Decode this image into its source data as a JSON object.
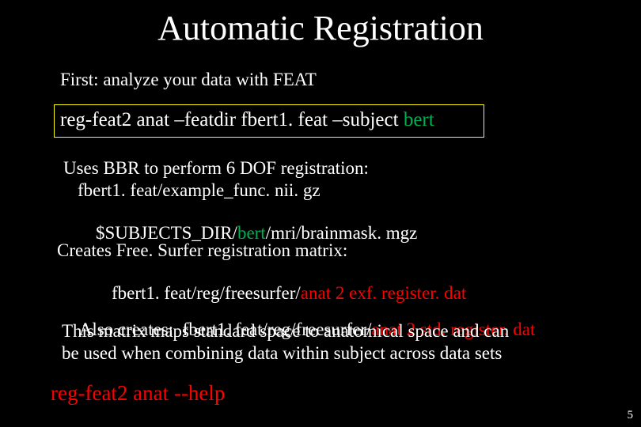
{
  "title": "Automatic Registration",
  "first": "First: analyze your data with FEAT",
  "cmd": {
    "pre": "reg-feat2 anat –featdir fbert1. feat –subject ",
    "subj": "bert"
  },
  "uses": {
    "l1": "Uses BBR to perform 6 DOF registration:",
    "l2": "fbert1. feat/example_func. nii. gz",
    "l3a": "$SUBJECTS_DIR/",
    "l3b": "bert",
    "l3c": "/mri/brainmask. mgz"
  },
  "creates": {
    "l1": "Creates Free. Surfer registration matrix:",
    "l2a": "fbert1. feat/reg/freesurfer/",
    "l2b": "anat 2 exf. register. dat"
  },
  "also": {
    "l1a": "Also creates:  fbert1. feat/reg/freesurfer/",
    "l1b": "anat 2 std. register. dat",
    "l2": "This matrix maps standard space to anatomical space and can",
    "l3": "be used when combining data within subject across data sets"
  },
  "help": "reg-feat2 anat --help",
  "page": "5"
}
